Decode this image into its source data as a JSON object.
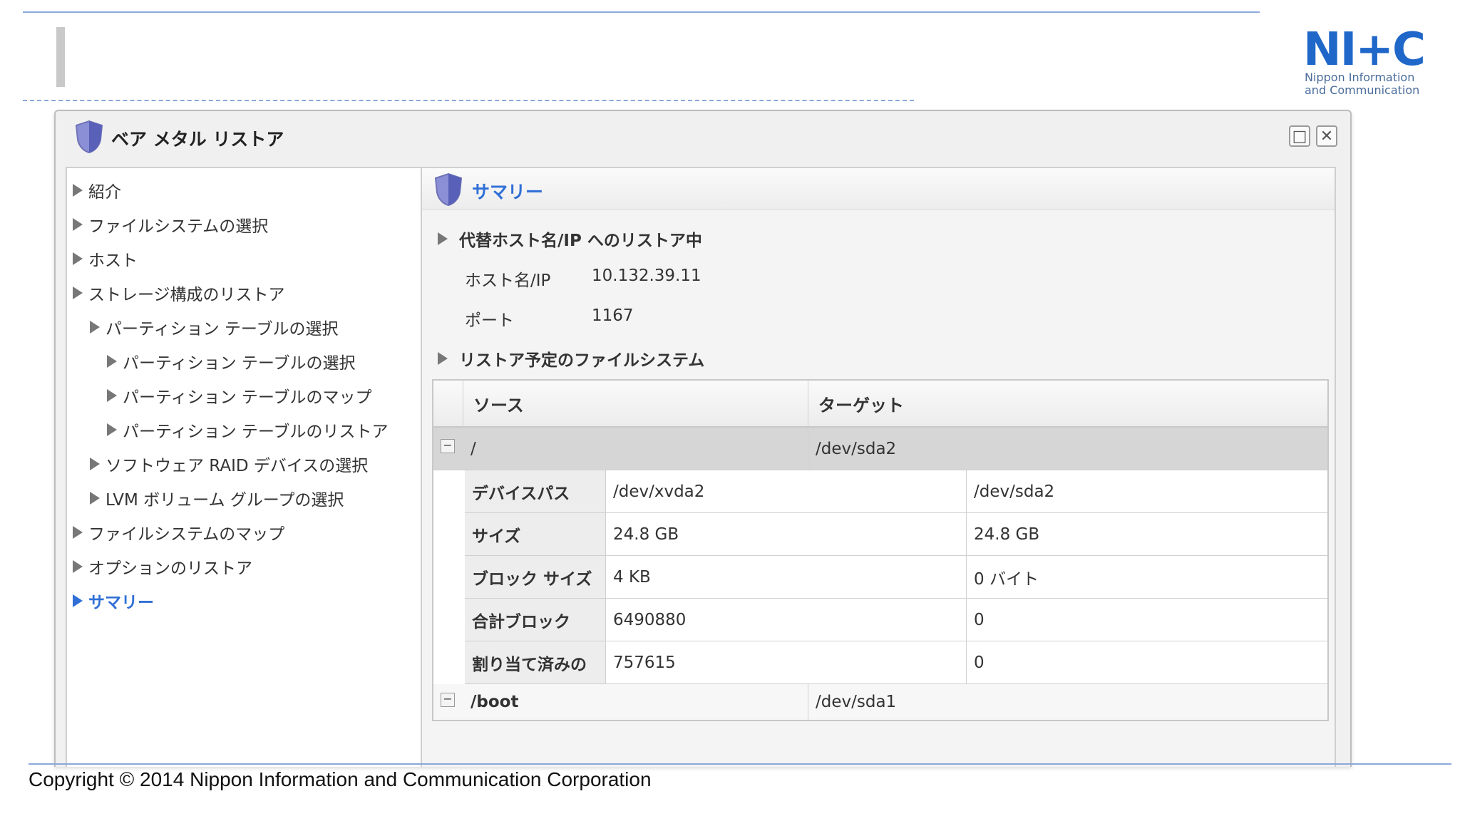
{
  "logo": {
    "mark": "NI+C",
    "line1": "Nippon Information",
    "line2": "and Communication"
  },
  "dialog": {
    "title": "ベア メタル リストア",
    "maximize_icon": "□",
    "close_icon": "✕"
  },
  "nav": {
    "items": [
      {
        "label": "紹介"
      },
      {
        "label": "ファイルシステムの選択"
      },
      {
        "label": "ホスト"
      },
      {
        "label": "ストレージ構成のリストア"
      },
      {
        "label": "パーティション テーブルの選択"
      },
      {
        "label": "パーティション テーブルの選択"
      },
      {
        "label": "パーティション テーブルのマップ"
      },
      {
        "label": "パーティション テーブルのリストア"
      },
      {
        "label": "ソフトウェア RAID デバイスの選択"
      },
      {
        "label": "LVM ボリューム グループの選択"
      },
      {
        "label": "ファイルシステムのマップ"
      },
      {
        "label": "オプションのリストア"
      },
      {
        "label": "サマリー"
      }
    ]
  },
  "summary": {
    "title": "サマリー",
    "section_host": "代替ホスト名/IP へのリストア中",
    "host_label": "ホスト名/IP",
    "host_value": "10.132.39.11",
    "port_label": "ポート",
    "port_value": "1167",
    "section_fs": "リストア予定のファイルシステム",
    "grid": {
      "col_source": "ソース",
      "col_target": "ターゲット",
      "group1": {
        "source": "/",
        "target": "/dev/sda2",
        "toggle": "−"
      },
      "details": [
        {
          "label": "デバイスパス",
          "source": "/dev/xvda2",
          "target": "/dev/sda2"
        },
        {
          "label": "サイズ",
          "source": "24.8 GB",
          "target": "24.8 GB"
        },
        {
          "label": "ブロック サイズ",
          "source": "4 KB",
          "target": "0 バイト"
        },
        {
          "label": "合計ブロック",
          "source": "6490880",
          "target": "0"
        },
        {
          "label": "割り当て済みの",
          "source": "757615",
          "target": "0"
        }
      ],
      "group2": {
        "source": "/boot",
        "target": "/dev/sda1",
        "toggle": "−"
      }
    }
  },
  "footer": {
    "copyright": "Copyright © 2014 Nippon Information and Communication Corporation"
  },
  "colors": {
    "accent": "#2f6fd6",
    "rule": "#8aa8d8",
    "logo": "#1f67c8"
  }
}
